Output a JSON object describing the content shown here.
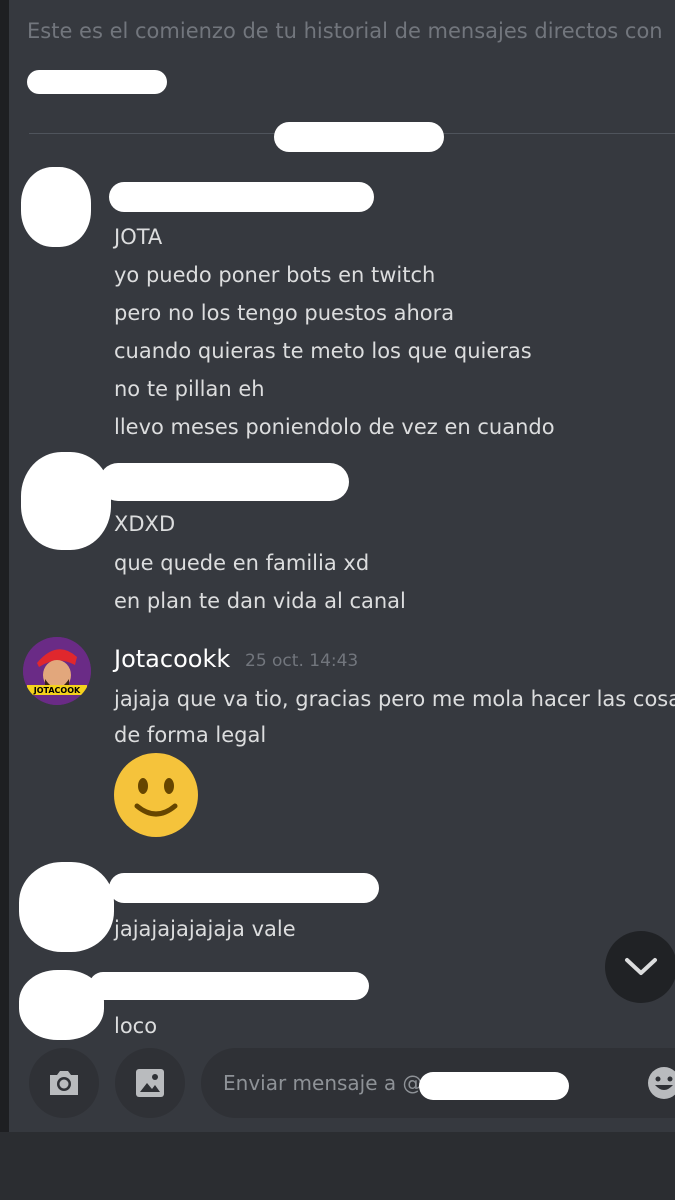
{
  "dm": {
    "intro_text": "Este es el comienzo de tu historial de mensajes directos con"
  },
  "messages": [
    {
      "lines": [
        "JOTA",
        "yo puedo poner bots en twitch",
        "pero no los tengo puestos ahora",
        "cuando quieras te meto los que quieras",
        "no te pillan eh",
        "llevo meses poniendolo de vez en cuando"
      ]
    },
    {
      "lines": [
        "XDXD",
        "que quede en familia xd",
        "en plan te dan vida al canal"
      ]
    },
    {
      "author": "Jotacookk",
      "timestamp": "25 oct. 14:43",
      "avatar_text": "JOTACOOK",
      "lines": [
        "jajaja que va tio, gracias pero me mola hacer las cosas",
        "de forma legal"
      ],
      "emoji": "slightly-smiling-face"
    },
    {
      "lines": [
        "jajajajajajaja vale"
      ]
    },
    {
      "lines": [
        "loco"
      ]
    }
  ],
  "composer": {
    "placeholder": "Enviar mensaje a @",
    "camera_icon": "camera-icon",
    "gallery_icon": "image-icon",
    "emoji_icon": "emoji-icon"
  },
  "colors": {
    "background": "#36393f",
    "text": "#dcddde",
    "muted": "#72767d",
    "avatar_bg": "#6a2b86"
  }
}
